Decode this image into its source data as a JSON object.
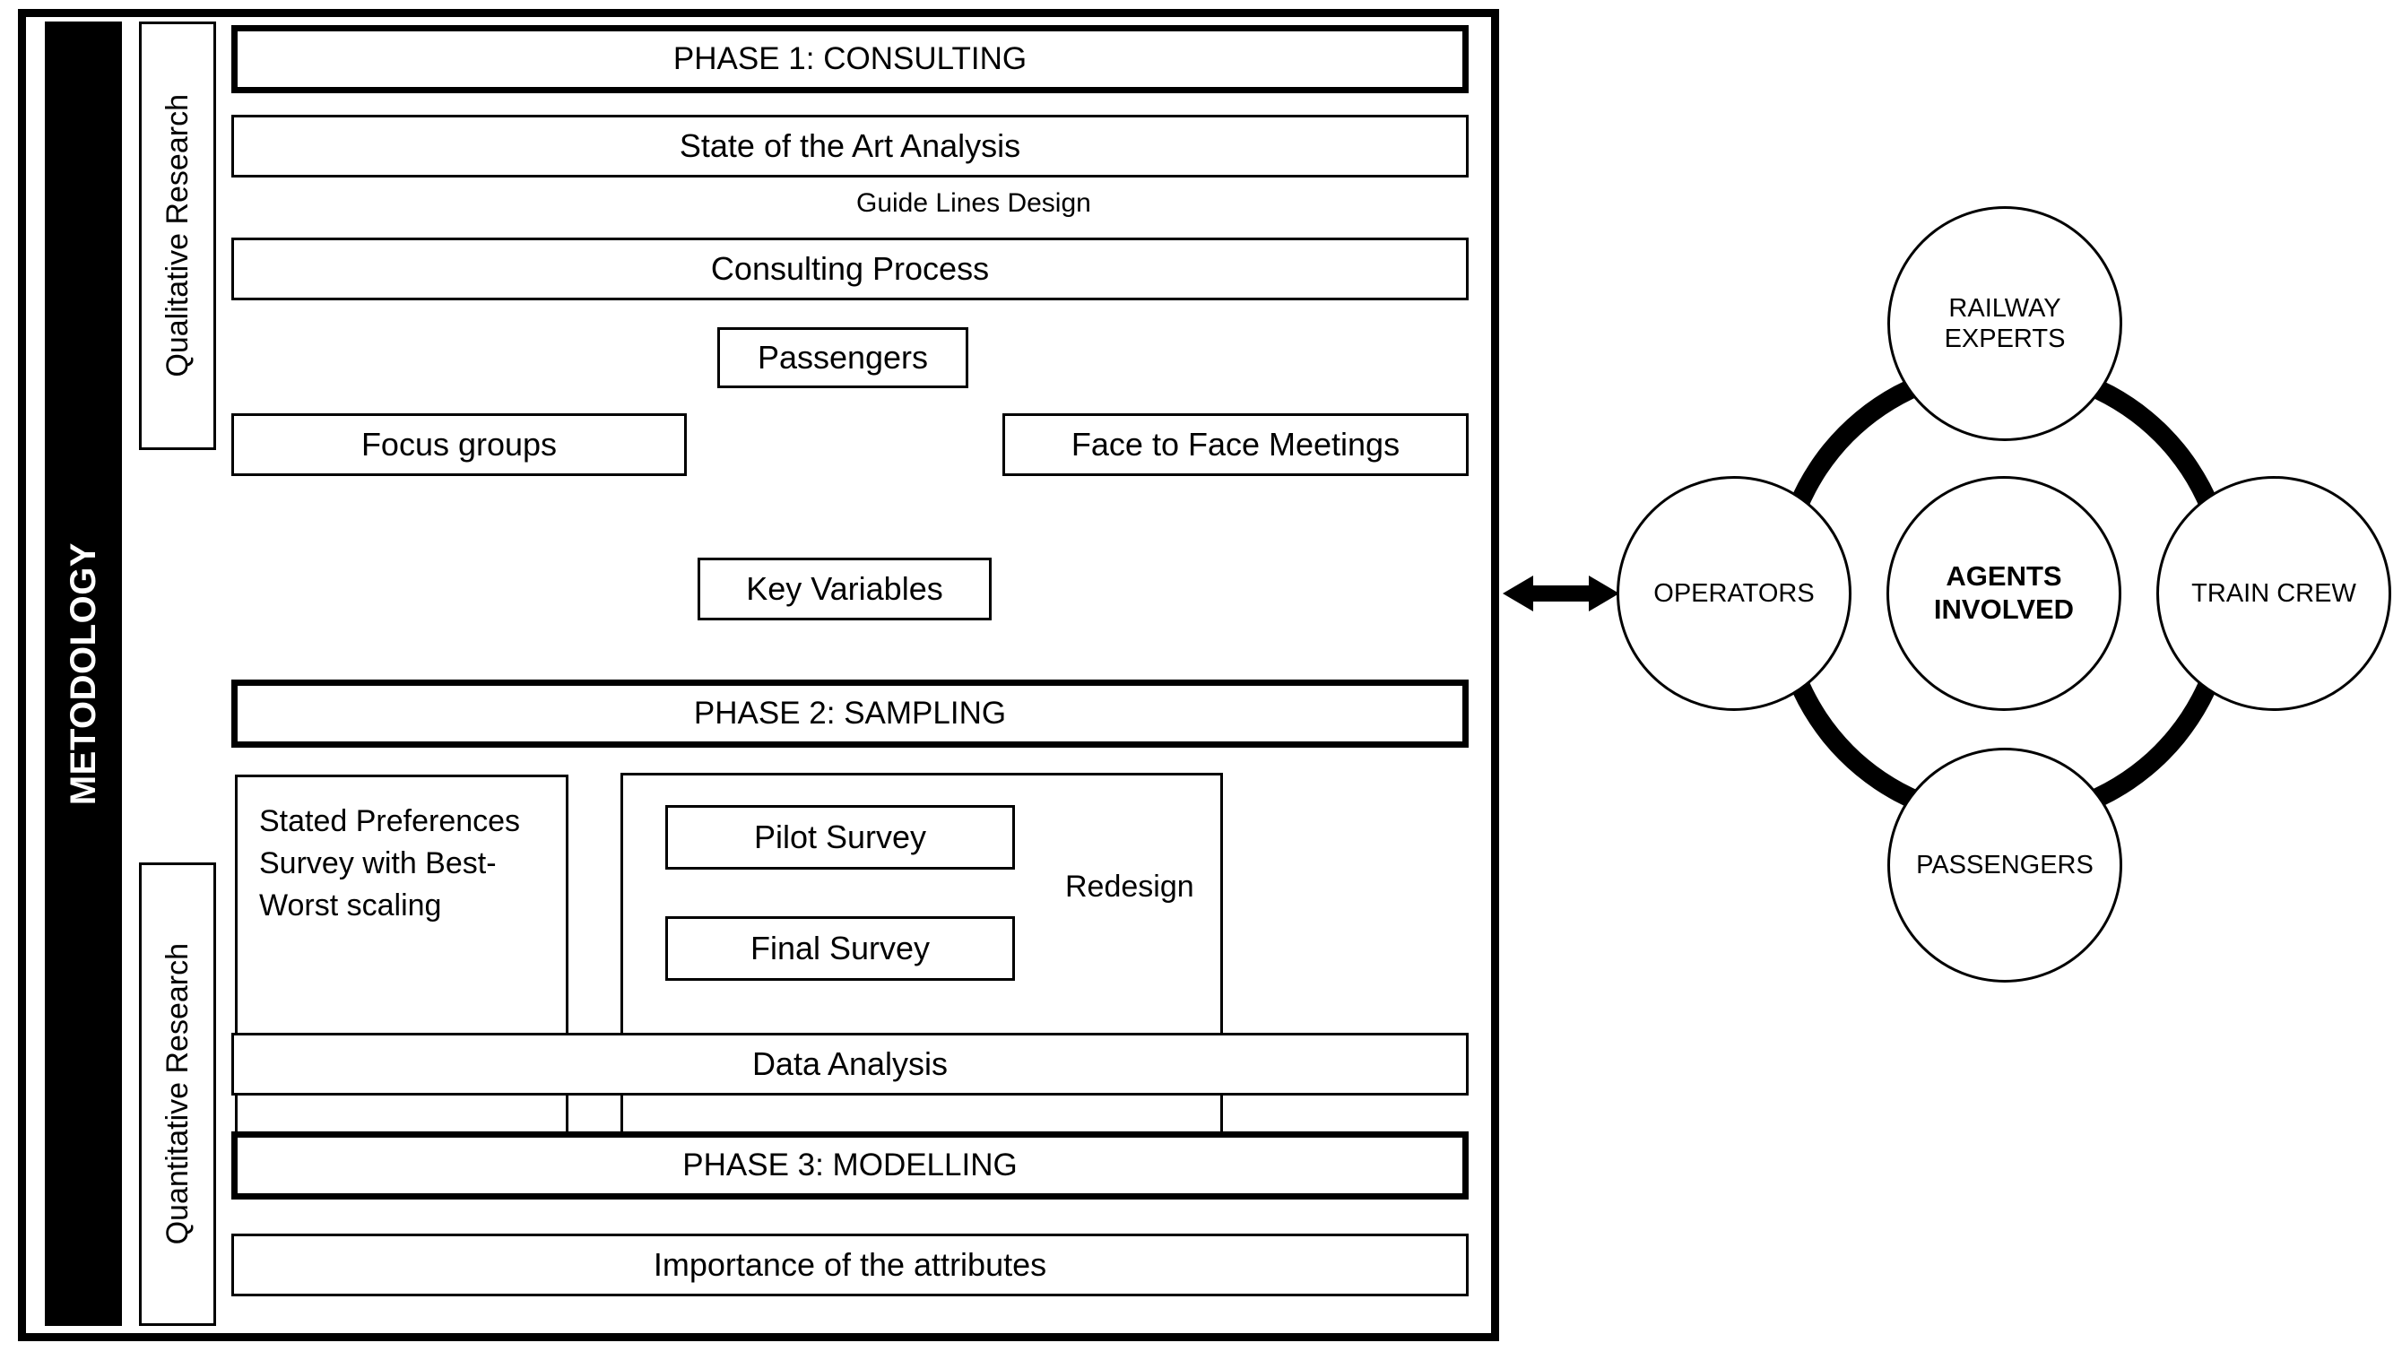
{
  "methodology": {
    "sidebar_label": "METODOLOGY",
    "research_tracks": [
      {
        "name": "qualitative-research",
        "label": "Qualitative Research"
      },
      {
        "name": "quantitative-research",
        "label": "Quantitative Research"
      }
    ],
    "flow": {
      "phase1": "PHASE 1: CONSULTING",
      "state_of_art": "State of the Art Analysis",
      "guide_lines_label": "Guide Lines Design",
      "consulting_process": "Consulting Process",
      "passengers": "Passengers",
      "focus_groups": "Focus groups",
      "face_to_face": "Face to Face Meetings",
      "key_variables": "Key Variables",
      "phase2": "PHASE 2: SAMPLING",
      "stated_preferences": "Stated Preferences Survey with Best-Worst scaling",
      "pilot_survey": "Pilot Survey",
      "final_survey": "Final Survey",
      "redesign_label": "Redesign",
      "data_analysis": "Data Analysis",
      "phase3": "PHASE 3: MODELLING",
      "importance": "Importance of the attributes"
    }
  },
  "agents": {
    "center": "AGENTS INVOLVED",
    "center_line1": "AGENTS",
    "center_line2": "INVOLVED",
    "nodes": [
      {
        "name": "railway-experts",
        "label": "RAILWAY EXPERTS",
        "line1": "RAILWAY",
        "line2": "EXPERTS",
        "position": "top"
      },
      {
        "name": "operators",
        "label": "OPERATORS",
        "position": "left"
      },
      {
        "name": "train-crew",
        "label": "TRAIN CREW",
        "position": "right"
      },
      {
        "name": "passengers",
        "label": "PASSENGERS",
        "position": "bottom"
      }
    ]
  },
  "colors": {
    "stroke": "#000000",
    "fill": "#ffffff",
    "bar_text": "#ffffff"
  }
}
